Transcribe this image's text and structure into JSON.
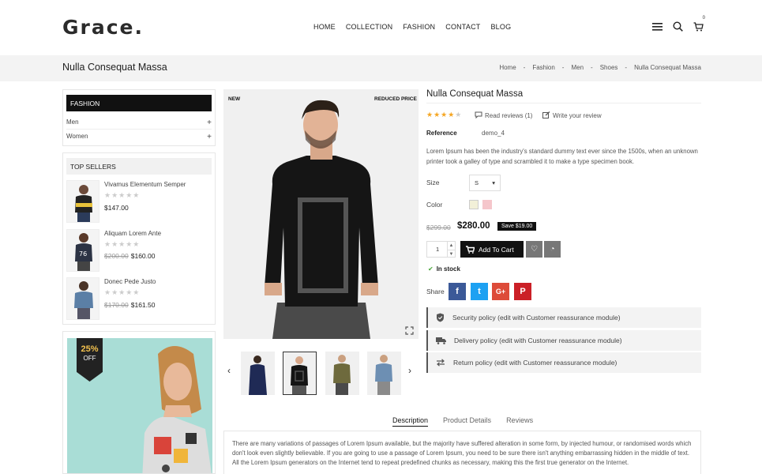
{
  "header": {
    "logo": "Grace.",
    "nav": [
      "HOME",
      "COLLECTION",
      "FASHION",
      "CONTACT",
      "BLOG"
    ],
    "cart_count": "0"
  },
  "breadcrumb": {
    "title": "Nulla Consequat Massa",
    "items": [
      "Home",
      "-",
      "Fashion",
      "-",
      "Men",
      "-",
      "Shoes",
      "-",
      "Nulla Consequat Massa"
    ]
  },
  "sidebar": {
    "category_title": "FASHION",
    "categories": [
      {
        "label": "Men",
        "toggle": "+"
      },
      {
        "label": "Women",
        "toggle": "+"
      }
    ],
    "top_sellers_title": "TOP SELLERS",
    "top_sellers": [
      {
        "name": "Vivamus Elementum Semper",
        "stars": "★★★★★",
        "old_price": "",
        "price": "$147.00"
      },
      {
        "name": "Aliquam Lorem Ante",
        "stars": "★★★★★",
        "old_price": "$200.00",
        "price": "$160.00"
      },
      {
        "name": "Donec Pede Justo",
        "stars": "★★★★★",
        "old_price": "$170.00",
        "price": "$161.50"
      }
    ],
    "banner": {
      "discount": "25%",
      "off": "OFF"
    }
  },
  "gallery": {
    "tag_new": "NEW",
    "tag_reduced": "REDUCED PRICE",
    "prev": "‹",
    "next": "›"
  },
  "product": {
    "title": "Nulla Consequat Massa",
    "rating": 4,
    "stars_on": "★★★★",
    "stars_off": "★",
    "read_reviews": "Read reviews (1)",
    "write_review": "Write your review",
    "reference_label": "Reference",
    "reference_value": "demo_4",
    "description": "Lorem Ipsum has been the industry's standard dummy text ever since the 1500s, when an unknown printer took a galley of type and scrambled it to make a type specimen book.",
    "size_label": "Size",
    "size_value": "S",
    "color_label": "Color",
    "colors": [
      "#f2f0d8",
      "#f5c6cb"
    ],
    "old_price": "$299.00",
    "price": "$280.00",
    "save": "Save $19.00",
    "quantity": "1",
    "add_to_cart": "Add To Cart",
    "stock": "In stock",
    "share_label": "Share",
    "social": [
      {
        "label": "f",
        "color": "#3b5998"
      },
      {
        "label": "t",
        "color": "#1da1f2"
      },
      {
        "label": "G+",
        "color": "#dd4b39"
      },
      {
        "label": "P",
        "color": "#cb2027"
      }
    ],
    "policies": [
      "Security policy (edit with Customer reassurance module)",
      "Delivery policy (edit with Customer reassurance module)",
      "Return policy (edit with Customer reassurance module)"
    ]
  },
  "tabs": [
    "Description",
    "Product Details",
    "Reviews"
  ],
  "tab_content": "There are many variations of passages of Lorem Ipsum available, but the majority have suffered alteration in some form, by injected humour, or randomised words which don't look even slightly believable. If you are going to use a passage of Lorem Ipsum, you need to be sure there isn't anything embarrassing hidden in the middle of text. All the Lorem Ipsum generators on the Internet tend to repeat predefined chunks as necessary, making this the first true generator on the Internet.",
  "colors": {
    "accent": "#111111",
    "star": "#f5a623",
    "in_stock": "#4aa83a",
    "banner_bg": "#a9ddd6"
  }
}
